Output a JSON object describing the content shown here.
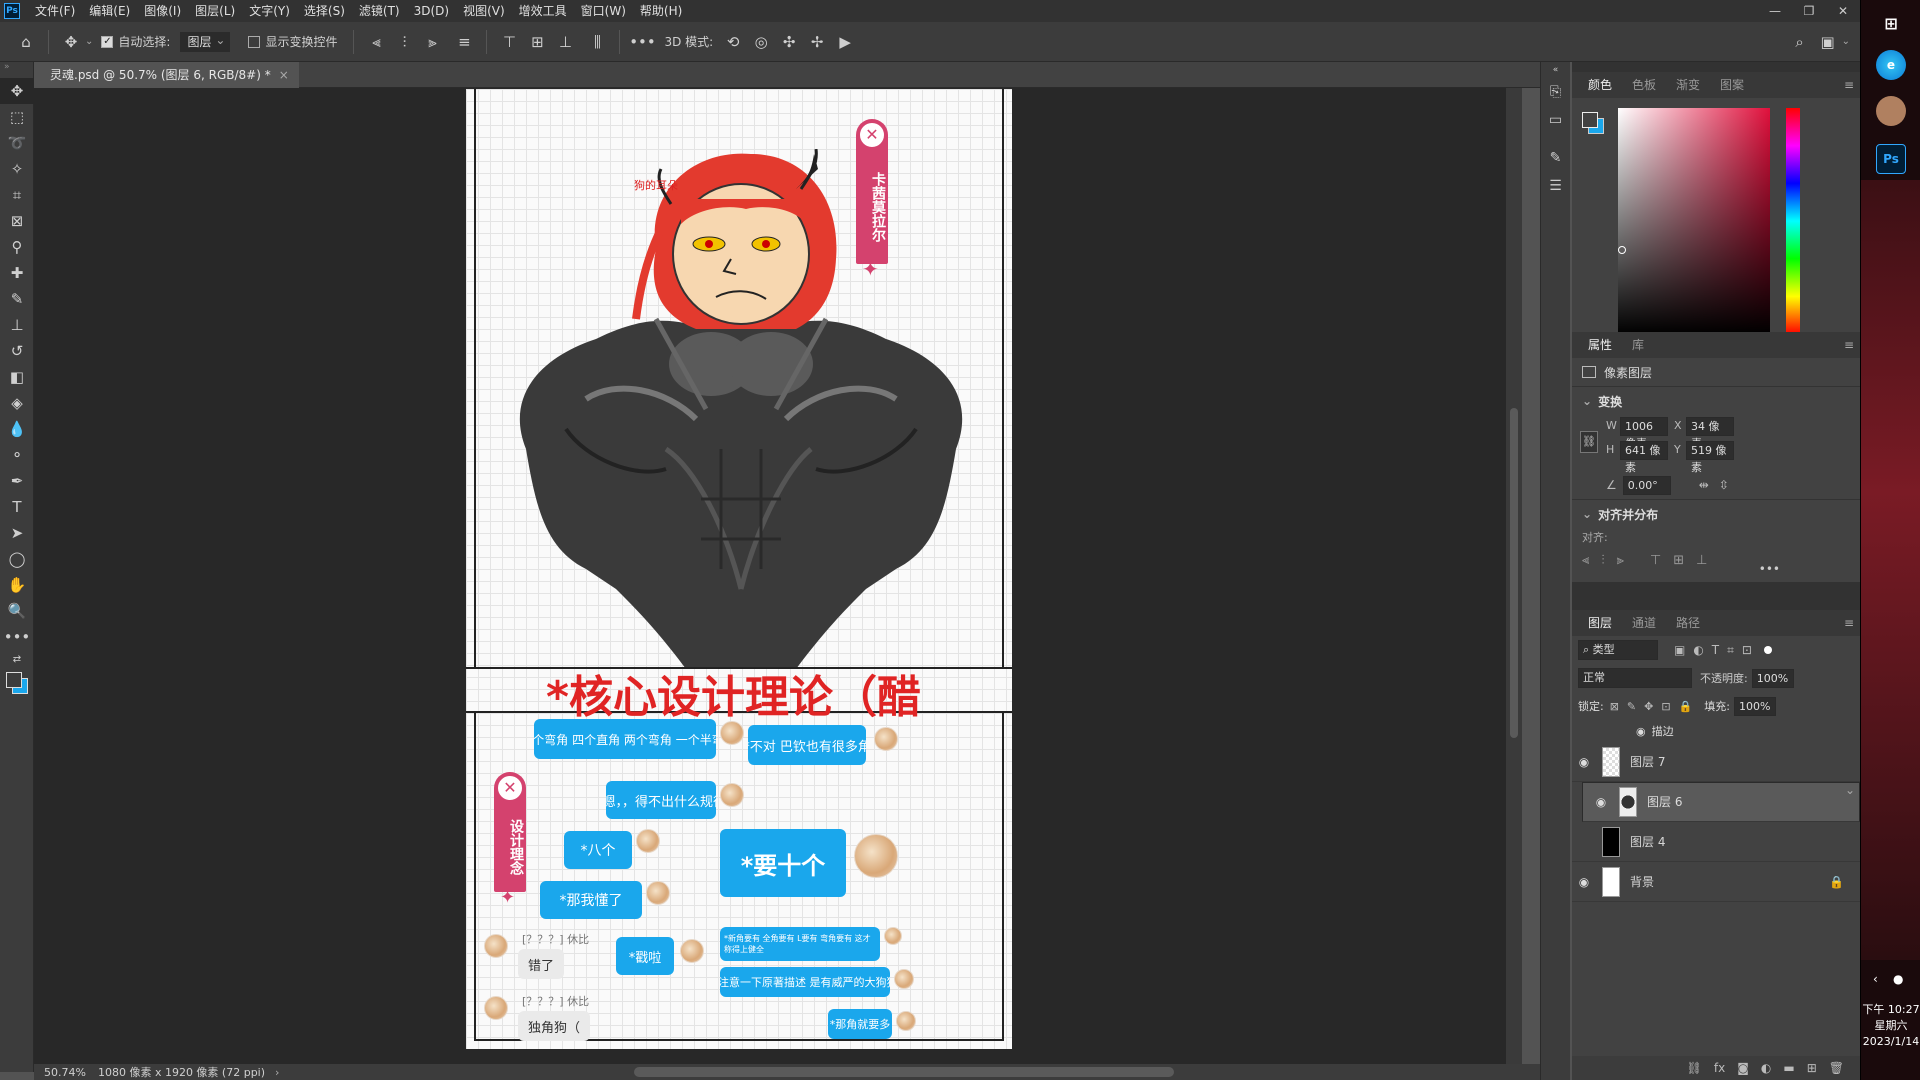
{
  "menubar": {
    "items": [
      "文件(F)",
      "编辑(E)",
      "图像(I)",
      "图层(L)",
      "文字(Y)",
      "选择(S)",
      "滤镜(T)",
      "3D(D)",
      "视图(V)",
      "增效工具",
      "窗口(W)",
      "帮助(H)"
    ]
  },
  "options": {
    "auto_select_label": "自动选择:",
    "auto_select_value": "图层",
    "show_transform_label": "显示变换控件",
    "mode_3d_label": "3D 模式:"
  },
  "document": {
    "tab_title": "灵魂.psd @ 50.7% (图层 6, RGB/8#) *",
    "ear_label": "狗的耳朵",
    "title_text": "*核心设计理论（醋",
    "banner_top": "卡茜莫拉尔",
    "banner_left": "设计理念",
    "chat": {
      "b1": "*两个弯角 四个直角 两个弯角 一个半弯角",
      "b2": "*不对 巴钦也有很多角",
      "b3": "*嗯，，得不出什么规律",
      "b4": "*八个",
      "b5": "*要十个",
      "b6": "*那我懂了",
      "b7": "*戳啦",
      "b8": "*新角要有 全角要有 L要有 弯角要有 这才称得上健全",
      "b9": "*注意一下原著描述 是有威严的大狗狗",
      "b10": "*那角就要多",
      "name1": "[？？？] 休比",
      "grey1": "错了",
      "name2": "[？？？] 休比",
      "grey2": "独角狗（"
    }
  },
  "status": {
    "zoom": "50.74%",
    "info": "1080 像素 x 1920 像素 (72 ppi)"
  },
  "color_panel": {
    "tabs": [
      "颜色",
      "色板",
      "渐变",
      "图案"
    ]
  },
  "properties_panel": {
    "tabs": [
      "属性",
      "库"
    ],
    "layer_type": "像素图层",
    "transform_heading": "变换",
    "w_label": "W",
    "w_value": "1006 像素",
    "x_label": "X",
    "x_value": "34 像素",
    "h_label": "H",
    "h_value": "641 像素",
    "y_label": "Y",
    "y_value": "519 像素",
    "angle_value": "0.00°",
    "align_heading": "对齐并分布",
    "align_label": "对齐:"
  },
  "layers_panel": {
    "tabs": [
      "图层",
      "通道",
      "路径"
    ],
    "filter_label": "类型",
    "blend_mode": "正常",
    "opacity_label": "不透明度:",
    "opacity_value": "100%",
    "lock_label": "锁定:",
    "fill_label": "填充:",
    "fill_value": "100%",
    "effect_label": "描边",
    "layers": [
      {
        "name": "图层 7",
        "visible": true
      },
      {
        "name": "图层 6",
        "visible": true,
        "selected": true
      },
      {
        "name": "图层 4",
        "visible": false
      },
      {
        "name": "背景",
        "visible": true,
        "locked": true
      }
    ]
  },
  "taskbar": {
    "time": "下午 10:27",
    "weekday": "星期六",
    "date": "2023/1/14"
  },
  "colors": {
    "accent_blue": "#1aa7ec",
    "title_red": "#e02424",
    "banner_pink": "#d4426e"
  }
}
